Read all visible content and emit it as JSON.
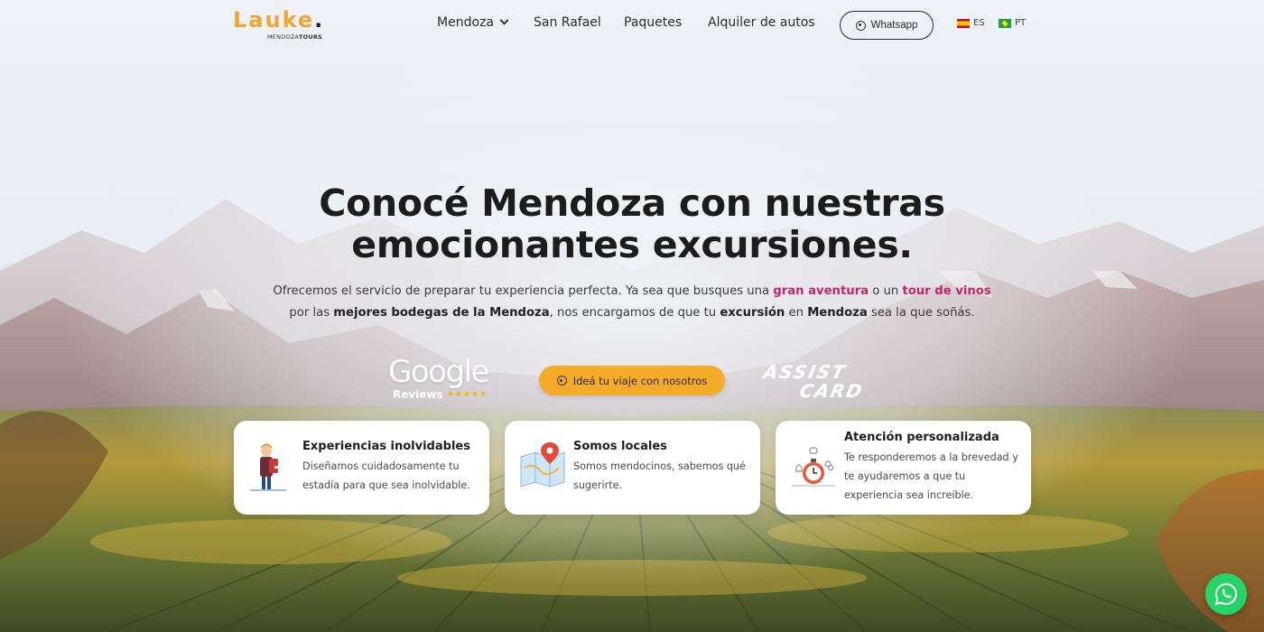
{
  "header": {
    "logo": {
      "word": "Lauke",
      "sub_light": "MENDOZA",
      "sub_bold": "TOURS"
    },
    "nav": [
      {
        "label": "Mendoza"
      },
      {
        "label": "San Rafael"
      },
      {
        "label": "Paquetes"
      },
      {
        "label": "Alquiler de autos"
      }
    ],
    "whatsapp_label": "Whatsapp",
    "languages": [
      {
        "code": "ES",
        "flag": "spain-flag-icon"
      },
      {
        "code": "PT",
        "flag": "brazil-flag-icon"
      }
    ]
  },
  "hero": {
    "title_line1": "Conocé Mendoza con nuestras",
    "title_line2": "emocionantes excursiones.",
    "text": {
      "t1": "Ofrecemos el servicio de preparar tu experiencia perfecta. Ya sea que busques una ",
      "h1": "gran aventura",
      "t2": " o un ",
      "h2": "tour de vinos",
      "t3": " por las ",
      "b1": "mejores bodegas de la Mendoza",
      "t4": ", nos encargamos de que tu ",
      "b2": "excursión",
      "t5": " en ",
      "b3": "Mendoza",
      "t6": " sea la que soñás."
    },
    "cta_label": "Ideá tu viaje con nosotros",
    "google": {
      "word": "Google",
      "sub": "Reviews",
      "stars": "★★★★★"
    },
    "assist": {
      "line1": "ASSIST",
      "line2": "CARD"
    }
  },
  "cards": [
    {
      "title": "Experiencias inolvidables",
      "desc": "Diseñamos cuidadosamente tu estadía para que sea inolvidable.",
      "icon": "traveler-icon"
    },
    {
      "title": "Somos locales",
      "desc": "Somos mendocinos, sabemos qué sugerirte.",
      "icon": "map-pin-icon"
    },
    {
      "title": "Atención personalizada",
      "desc": "Te responderemos a la brevedad y te ayudaremos a que tu experiencia sea increíble.",
      "icon": "stopwatch-icon"
    }
  ],
  "colors": {
    "accent": "#f6ab2a",
    "highlight": "#c4256a",
    "whatsapp": "#25d366"
  }
}
